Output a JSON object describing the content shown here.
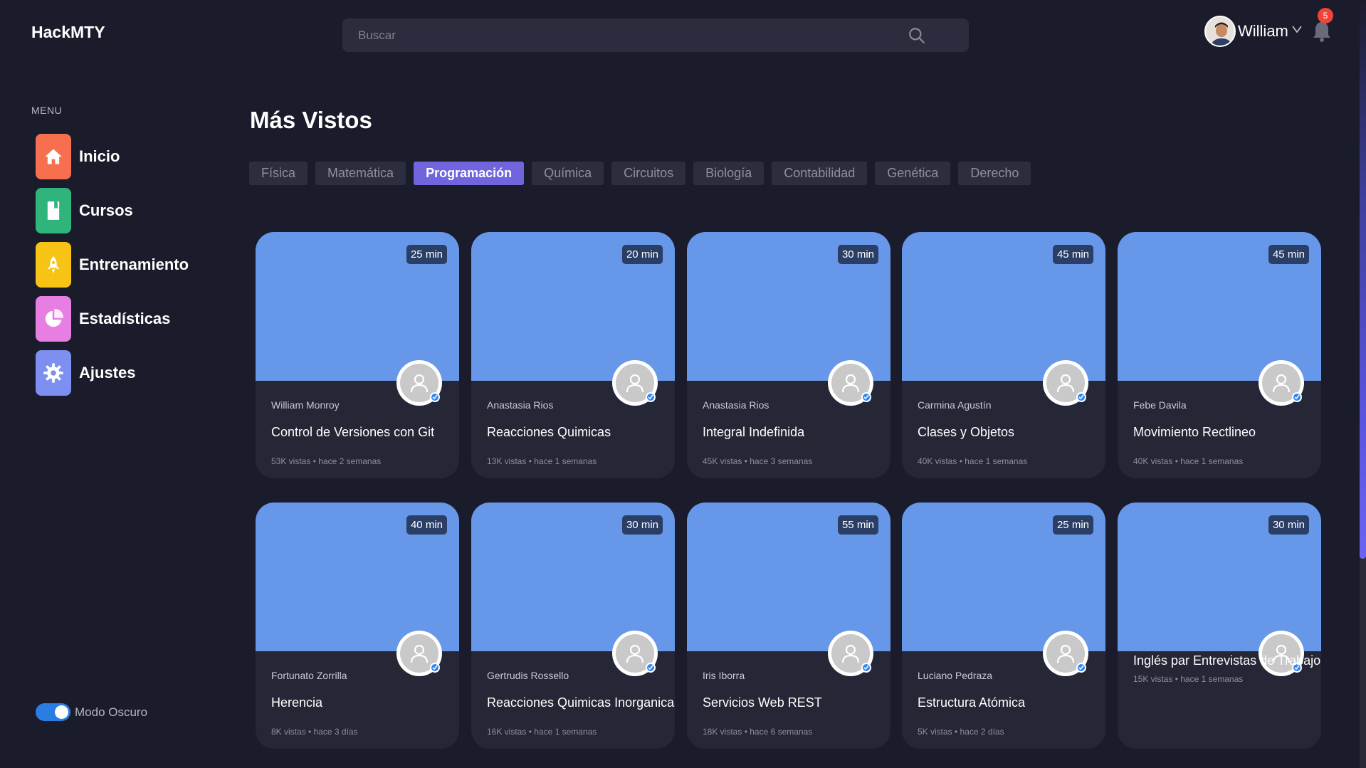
{
  "app": {
    "logo": "HackMTY"
  },
  "search": {
    "placeholder": "Buscar"
  },
  "user": {
    "name": "William",
    "notifications": "5"
  },
  "menu": {
    "label": "MENU",
    "items": [
      {
        "label": "Inicio",
        "icon": "home-icon",
        "color": "#f6704f"
      },
      {
        "label": "Cursos",
        "icon": "book-icon",
        "color": "#2fb47c"
      },
      {
        "label": "Entrenamiento",
        "icon": "rocket-icon",
        "color": "#f7c315"
      },
      {
        "label": "Estadísticas",
        "icon": "pie-chart-icon",
        "color": "#e77fe3"
      },
      {
        "label": "Ajustes",
        "icon": "gear-icon",
        "color": "#7d8ff0"
      }
    ],
    "dark_mode_label": "Modo Oscuro"
  },
  "main": {
    "title": "Más Vistos",
    "tabs": [
      "Física",
      "Matemática",
      "Programación",
      "Química",
      "Circuitos",
      "Biología",
      "Contabilidad",
      "Genética",
      "Derecho"
    ],
    "active_tab": "Programación",
    "cards": [
      {
        "duration": "25 min",
        "author": "William Monroy",
        "title": "Control de Versiones con Git",
        "meta": "53K vistas • hace 2 semanas"
      },
      {
        "duration": "20 min",
        "author": "Anastasia Rios",
        "title": "Reacciones Quimicas",
        "meta": "13K vistas • hace 1 semanas"
      },
      {
        "duration": "30 min",
        "author": "Anastasia Rios",
        "title": "Integral Indefinida",
        "meta": "45K vistas • hace 3 semanas"
      },
      {
        "duration": "45 min",
        "author": "Carmina Agustín",
        "title": "Clases y Objetos",
        "meta": "40K vistas • hace 1 semanas"
      },
      {
        "duration": "45 min",
        "author": "Febe Davila",
        "title": "Movimiento Rectlineo",
        "meta": "40K vistas • hace 1 semanas"
      },
      {
        "duration": "40 min",
        "author": "Fortunato Zorrilla",
        "title": "Herencia",
        "meta": "8K vistas • hace 3 días"
      },
      {
        "duration": "30 min",
        "author": "Gertrudis Rossello",
        "title": "Reacciones Quimicas Inorganicas",
        "meta": "16K vistas • hace 1 semanas"
      },
      {
        "duration": "55 min",
        "author": "Iris Iborra",
        "title": "Servicios Web REST",
        "meta": "18K vistas • hace 6 semanas"
      },
      {
        "duration": "25 min",
        "author": "Luciano Pedraza",
        "title": "Estructura Atómica",
        "meta": "5K vistas • hace 2 días"
      },
      {
        "duration": "30 min",
        "author": "",
        "title": "Inglés par Entrevistas de Trabajo",
        "meta": "15K vistas • hace 1 semanas"
      }
    ]
  }
}
